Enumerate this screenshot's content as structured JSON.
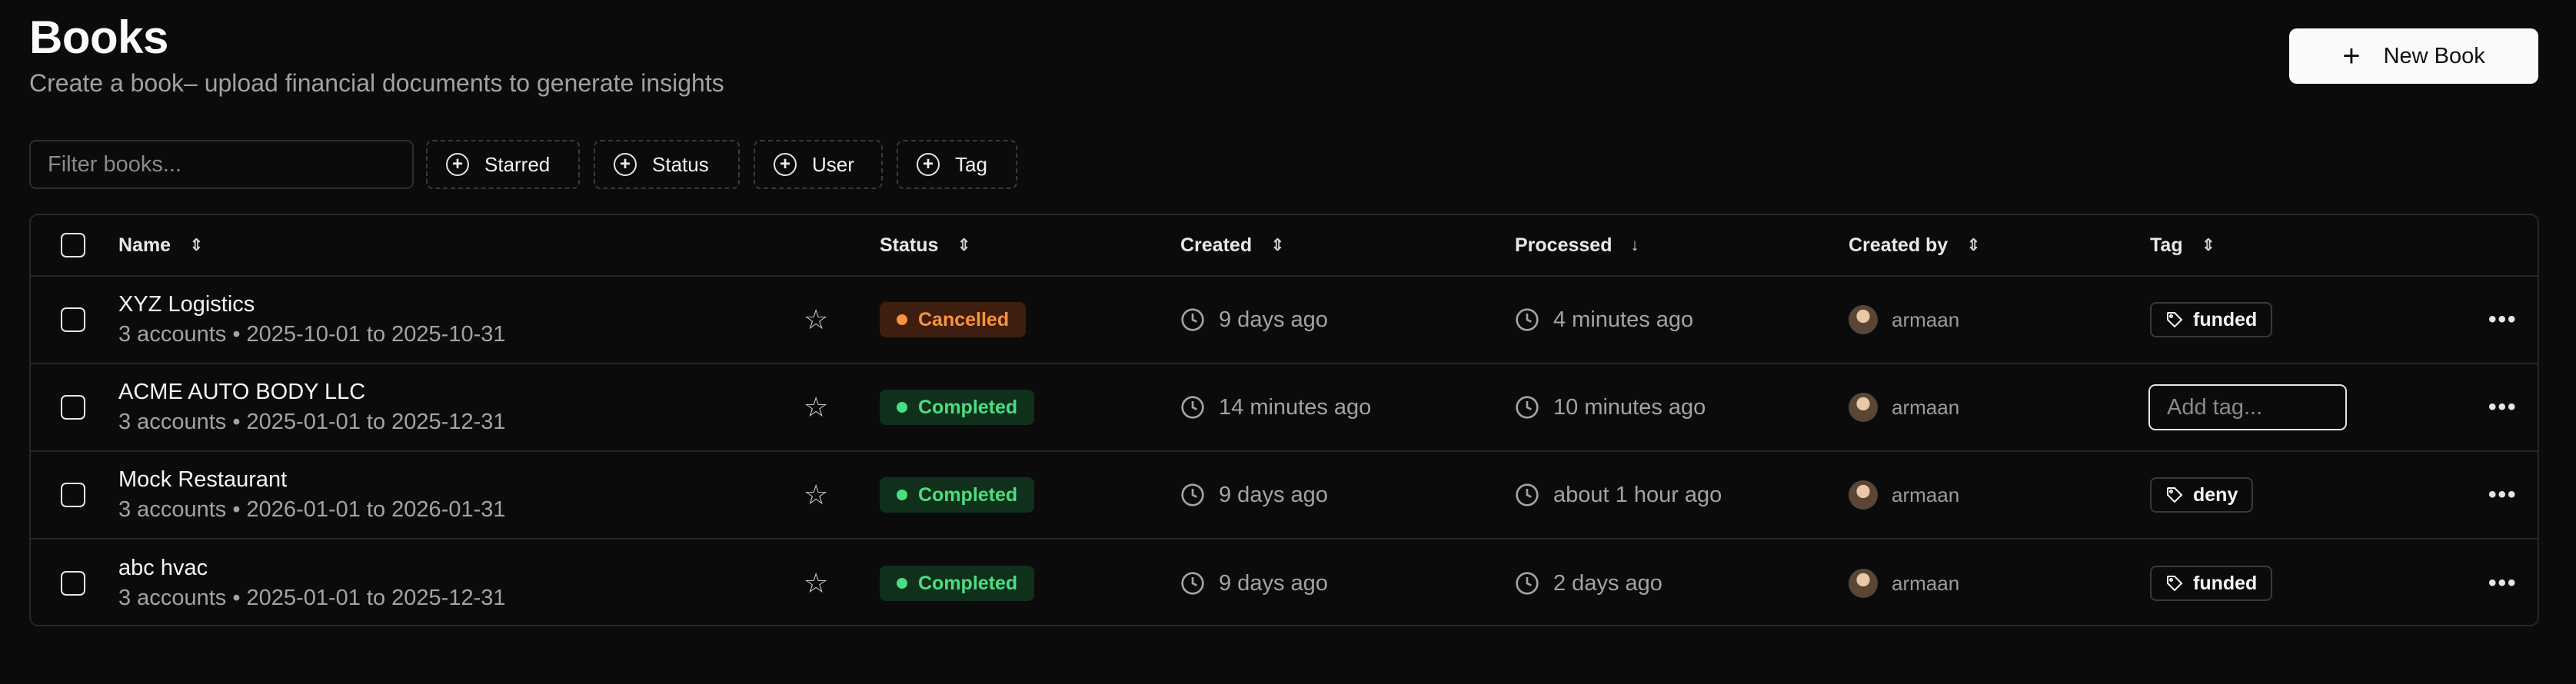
{
  "header": {
    "title": "Books",
    "subtitle": "Create a book– upload financial documents to generate insights",
    "new_button": "New Book"
  },
  "filters": {
    "placeholder": "Filter books...",
    "chips": [
      "Starred",
      "Status",
      "User",
      "Tag"
    ]
  },
  "table": {
    "columns": [
      "Name",
      "Status",
      "Created",
      "Processed",
      "Created by",
      "Tag"
    ],
    "rows": [
      {
        "name": "XYZ Logistics",
        "meta": "3 accounts • 2025-10-01 to 2025-10-31",
        "status": "Cancelled",
        "created": "9 days ago",
        "processed": "4 minutes ago",
        "user": "armaan",
        "tag": "funded"
      },
      {
        "name": "ACME AUTO BODY LLC",
        "meta": "3 accounts • 2025-01-01 to 2025-12-31",
        "status": "Completed",
        "created": "14 minutes ago",
        "processed": "10 minutes ago",
        "user": "armaan",
        "tag_placeholder": "Add tag..."
      },
      {
        "name": "Mock Restaurant",
        "meta": "3 accounts • 2026-01-01 to 2026-01-31",
        "status": "Completed",
        "created": "9 days ago",
        "processed": "about 1 hour ago",
        "user": "armaan",
        "tag": "deny"
      },
      {
        "name": "abc hvac",
        "meta": "3 accounts • 2025-01-01 to 2025-12-31",
        "status": "Completed",
        "created": "9 days ago",
        "processed": "2 days ago",
        "user": "armaan",
        "tag": "funded"
      }
    ]
  },
  "colors": {
    "background": "#0b0b0b",
    "cancelled": "#fb923c",
    "completed": "#4ade80"
  }
}
